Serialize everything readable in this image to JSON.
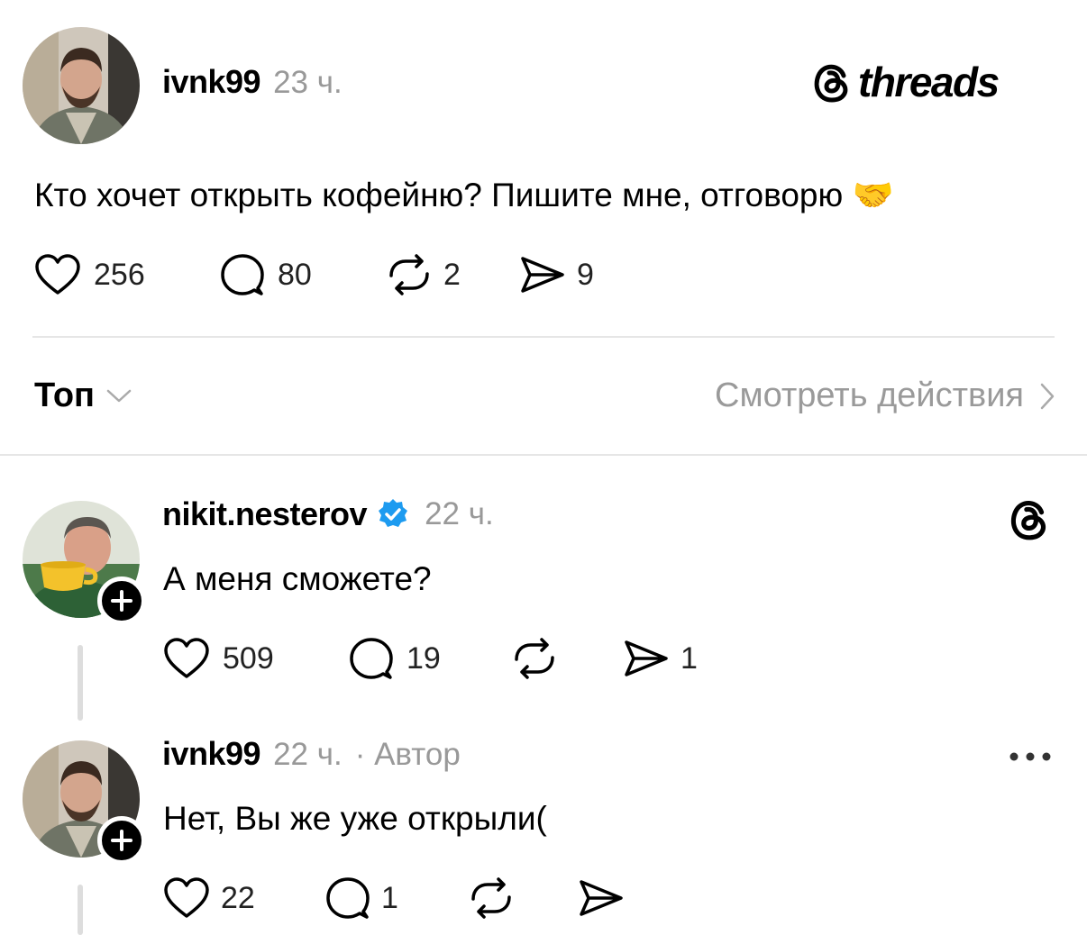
{
  "post": {
    "username": "ivnk99",
    "time": "23 ч.",
    "brand": "threads",
    "text": "Кто хочет открыть кофейню? Пишите мне, отговорю 🤝",
    "likes": "256",
    "comments": "80",
    "reposts": "2",
    "shares": "9"
  },
  "sort_bar": {
    "sort_label": "Топ",
    "activity_label": "Смотреть действия"
  },
  "replies": [
    {
      "username": "nikit.nesterov",
      "verified": true,
      "time": "22 ч.",
      "text": "А меня сможете?",
      "likes": "509",
      "comments": "19",
      "reposts": "",
      "shares": "1"
    },
    {
      "username": "ivnk99",
      "time": "22 ч.",
      "author_tag": "· Автор",
      "text": "Нет, Вы же уже открыли(",
      "likes": "22",
      "comments": "1",
      "reposts": "",
      "shares": ""
    }
  ],
  "colors": {
    "verified": "#1d9bf0",
    "muted": "#999999",
    "divider": "#e6e6e6"
  }
}
